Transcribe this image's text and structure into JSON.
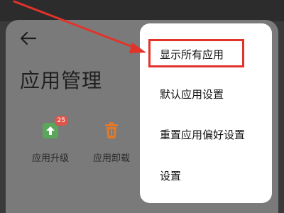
{
  "page": {
    "title": "应用管理",
    "back_icon": "back-arrow-icon"
  },
  "quick_actions": [
    {
      "label": "应用升级",
      "icon": "upgrade-icon",
      "badge": "25",
      "color": "#5aa65a"
    },
    {
      "label": "应用卸载",
      "icon": "trash-icon",
      "color": "#e07a2a"
    }
  ],
  "menu": {
    "items": [
      {
        "label": "显示所有应用",
        "highlighted": true
      },
      {
        "label": "默认应用设置"
      },
      {
        "label": "重置应用偏好设置"
      },
      {
        "label": "设置"
      }
    ]
  },
  "annotation": {
    "color": "#e2332a"
  }
}
